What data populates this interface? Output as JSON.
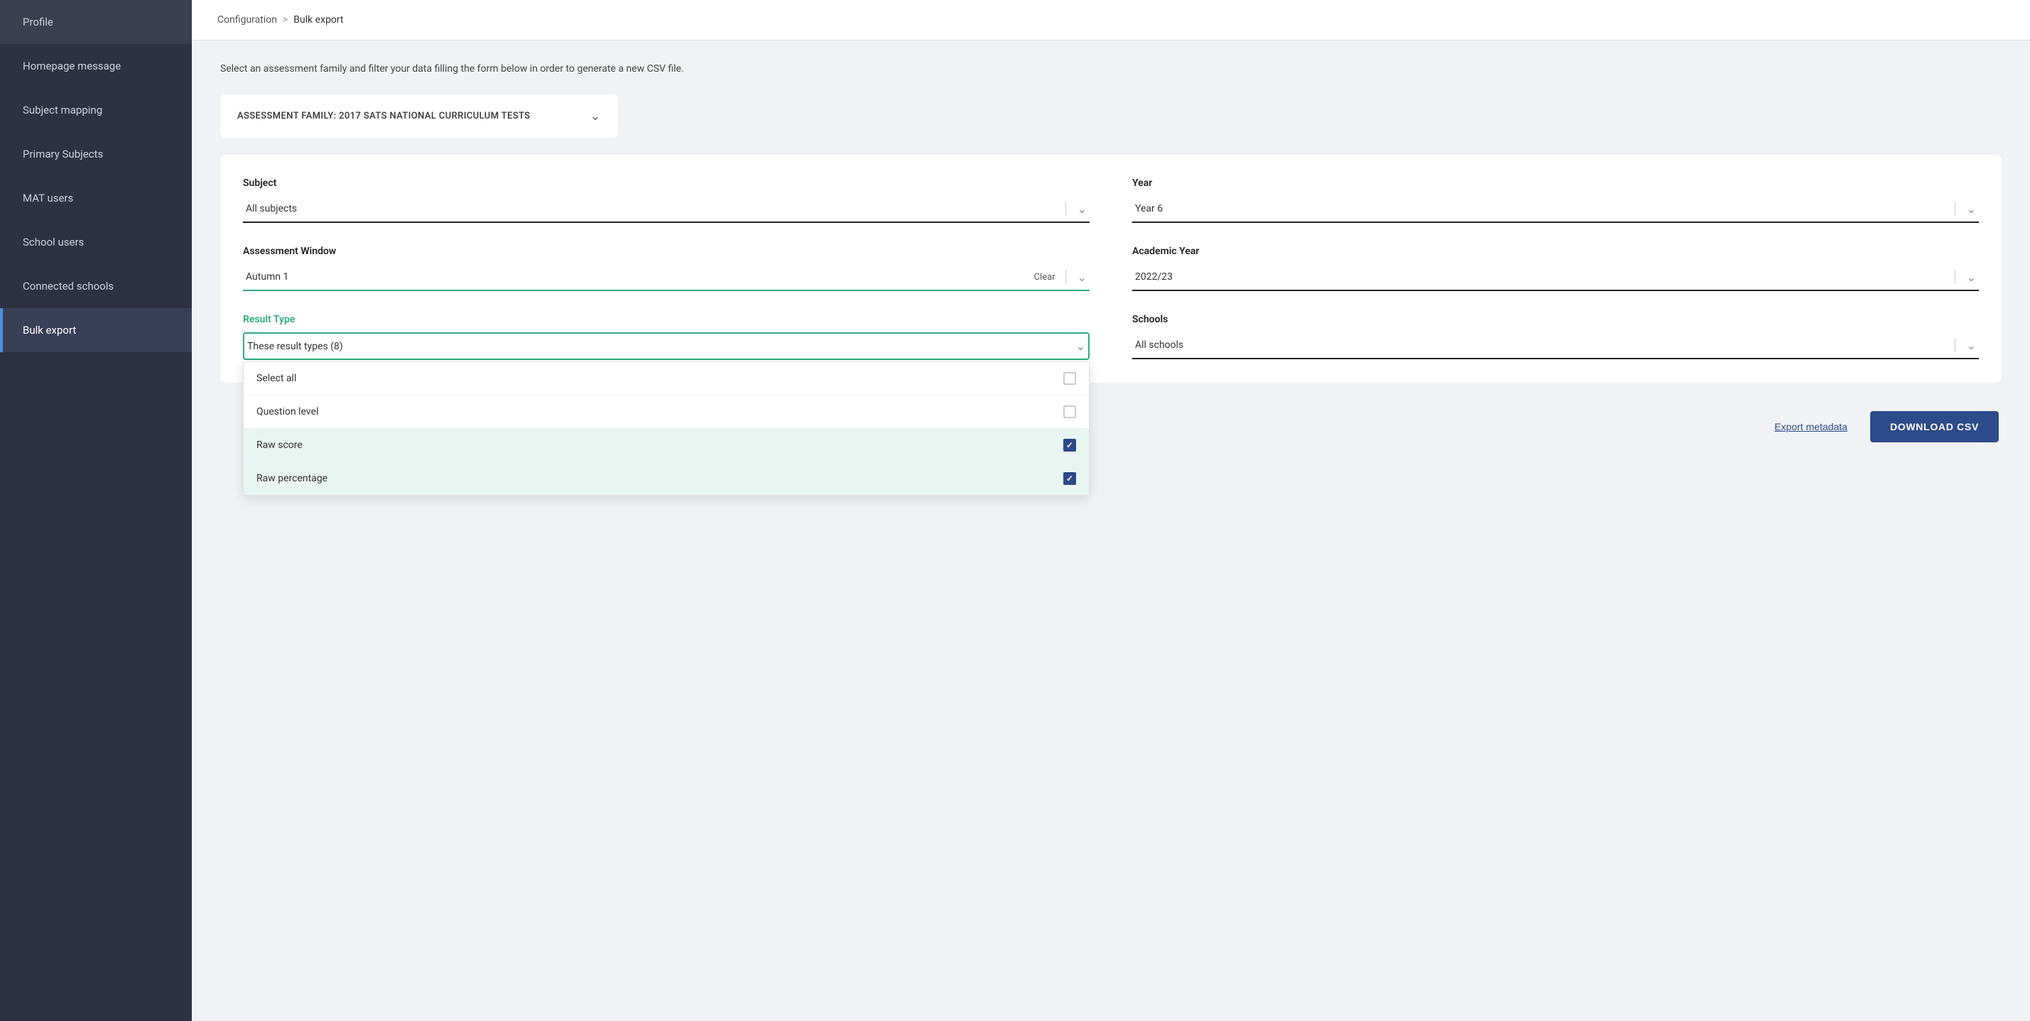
{
  "sidebar": {
    "items": [
      {
        "id": "profile",
        "label": "Profile",
        "active": false
      },
      {
        "id": "homepage-message",
        "label": "Homepage message",
        "active": false
      },
      {
        "id": "subject-mapping",
        "label": "Subject mapping",
        "active": false
      },
      {
        "id": "primary-subjects",
        "label": "Primary Subjects",
        "active": false
      },
      {
        "id": "mat-users",
        "label": "MAT users",
        "active": false
      },
      {
        "id": "school-users",
        "label": "School users",
        "active": false
      },
      {
        "id": "connected-schools",
        "label": "Connected schools",
        "active": false
      },
      {
        "id": "bulk-export",
        "label": "Bulk export",
        "active": true
      }
    ]
  },
  "breadcrumb": {
    "parent": "Configuration",
    "separator": ">",
    "current": "Bulk export"
  },
  "intro": {
    "text": "Select an assessment family and filter your data filling the form below in order to generate a new CSV file."
  },
  "assessment_family": {
    "label": "ASSESSMENT FAMILY: 2017 SATS NATIONAL CURRICULUM TESTS"
  },
  "filters": {
    "subject": {
      "label": "Subject",
      "value": "All subjects"
    },
    "year": {
      "label": "Year",
      "value": "Year 6"
    },
    "assessment_window": {
      "label": "Assessment Window",
      "value": "Autumn 1",
      "clear_label": "Clear"
    },
    "academic_year": {
      "label": "Academic Year",
      "value": "2022/23"
    },
    "result_type": {
      "label": "Result Type",
      "value": "These result types (8)",
      "is_open": true
    },
    "schools": {
      "label": "Schools",
      "value": "All schools"
    }
  },
  "dropdown_items": [
    {
      "label": "Select all",
      "checked": false
    },
    {
      "label": "Question level",
      "checked": false
    },
    {
      "label": "Raw score",
      "checked": true
    },
    {
      "label": "Raw percentage",
      "checked": true
    }
  ],
  "actions": {
    "export_metadata": "Export metadata",
    "download_csv": "DOWNLOAD CSV"
  }
}
